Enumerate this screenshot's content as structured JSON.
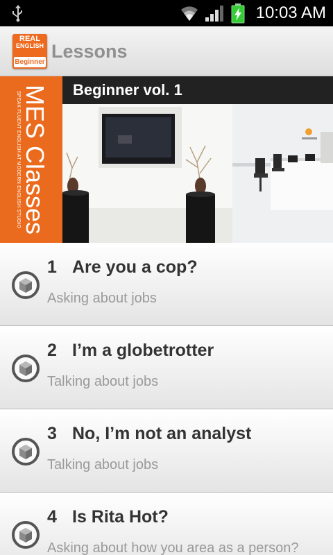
{
  "status_bar": {
    "time": "10:03 AM",
    "icons": [
      "usb-icon",
      "wifi-icon",
      "signal-icon",
      "battery-charging-icon"
    ]
  },
  "action_bar": {
    "logo": {
      "line1": "REAL",
      "line2": "ENGLISH",
      "line3": "Beginner"
    },
    "title": "Lessons"
  },
  "banner": {
    "side_title": "MES Classes",
    "side_subtitle": "SPEAK FLUENT ENGLISH AT MODERN ENGLISH STUDIO",
    "volume_title": "Beginner vol. 1"
  },
  "lessons": [
    {
      "number": "1",
      "title": "Are you a cop?",
      "subtitle": "Asking about jobs"
    },
    {
      "number": "2",
      "title": "I’m a globetrotter",
      "subtitle": "Talking about jobs"
    },
    {
      "number": "3",
      "title": "No, I’m not an analyst",
      "subtitle": "Talking about jobs"
    },
    {
      "number": "4",
      "title": "Is Rita Hot?",
      "subtitle": "Asking about how you area as  a person?"
    }
  ],
  "colors": {
    "brand_orange": "#ea6b1d",
    "action_bar_title": "#909090",
    "volume_bar": "#222222",
    "lesson_title": "#333333",
    "lesson_subtitle": "#9a9a9a"
  }
}
